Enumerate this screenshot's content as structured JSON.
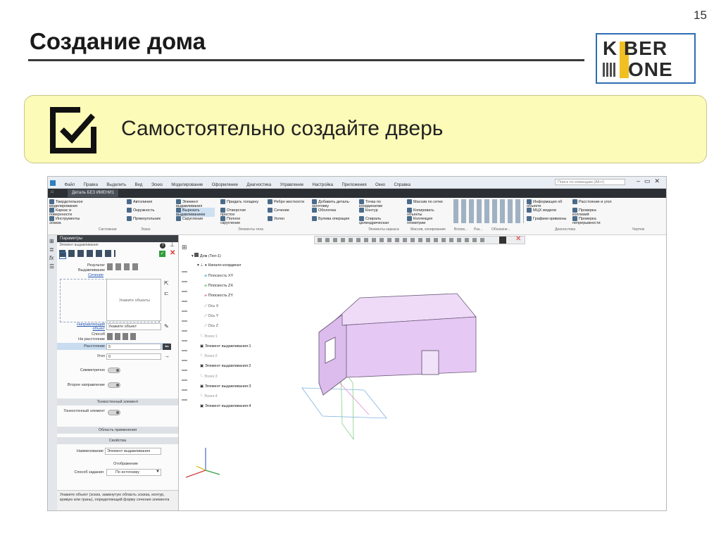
{
  "slide": {
    "number": "15",
    "title": "Создание дома",
    "task_text": "Самостоятельно создайте дверь"
  },
  "logo": {
    "line1": "K BER",
    "line2": "ONE",
    "accent_color": "#f0c020",
    "border_color": "#2f6db5"
  },
  "task_box": {
    "background": "#fdfbb8",
    "icon": "checkbox-checked-icon"
  },
  "app": {
    "menu": [
      "Файл",
      "Правка",
      "Выделить",
      "Вид",
      "Эскиз",
      "Моделирование",
      "Оформление",
      "Диагностика",
      "Управление",
      "Настройка",
      "Приложения",
      "Окно",
      "Справка"
    ],
    "search_placeholder": "Поиск по командам (Alt+/)",
    "doc_tab": "Деталь БЕЗ ИМЕНИ1",
    "ribbon": {
      "items": [
        {
          "label": "Твердотельное моделирование"
        },
        {
          "label": "Каркас и поверхности"
        },
        {
          "label": "Инструменты эскиза"
        },
        {
          "label": "Автолиния"
        },
        {
          "label": "Окружность"
        },
        {
          "label": "Прямоугольник"
        },
        {
          "label": "Элемент выдавливания"
        },
        {
          "label": "Вырезать выдавливанием"
        },
        {
          "label": "Скругление"
        },
        {
          "label": "Придать толщину"
        },
        {
          "label": "Отверстие простое"
        },
        {
          "label": "Полное скругление"
        },
        {
          "label": "Ребро жесткости"
        },
        {
          "label": "Сечение"
        },
        {
          "label": "Уклон"
        },
        {
          "label": "Добавить деталь-заготовку"
        },
        {
          "label": "Оболочка"
        },
        {
          "label": "Булева операция"
        },
        {
          "label": "Точка по координатам"
        },
        {
          "label": "Контур"
        },
        {
          "label": "Спираль цилиндрическая"
        },
        {
          "label": "Массив по сетке"
        },
        {
          "label": "Копировать объекты"
        },
        {
          "label": "Коллекция геометрии"
        },
        {
          "label": "Информация об объекте"
        },
        {
          "label": "МЦХ модели"
        },
        {
          "label": "Графики кривизны"
        },
        {
          "label": "Расстояние и угол"
        },
        {
          "label": "Проверка коллизий"
        },
        {
          "label": "Проверка непрерывности"
        }
      ],
      "groups": [
        "Системная",
        "Эскиз",
        "Элементы тела",
        "Элементы каркаса",
        "Массив, копирование",
        "Вспом...",
        "Раз...",
        "Обозначе...",
        "Диагностика",
        "Чертеж"
      ]
    },
    "panel": {
      "title": "Параметры",
      "subtitle": "Элемент выдавливания",
      "result_label": "Результат",
      "result_value": "Выдавливание",
      "section_link": "Сечение",
      "objects_hint": "Укажите объекты",
      "direction_link": "Направляющий объект",
      "direction_value": "Укажите объект",
      "method_label": "Способ",
      "method_value": "На расстояние",
      "distance_label": "Расстояние",
      "distance_value": "5",
      "angle_label": "Угол",
      "angle_value": "0",
      "symmetric_label": "Симметрично",
      "second_dir_label": "Второе направление",
      "thin_section": "Тонкостенный элемент",
      "thin_label": "Тонкостенный элемент",
      "scope_section": "Область применения",
      "props_section": "Свойства",
      "name_label": "Наименование",
      "name_value": "Элемент выдавливания",
      "display_label": "Отображение",
      "method2_label": "Способ задания",
      "method2_value": "По источнику",
      "status": "Укажите объект (эскиз, замкнутую область эскиза, контур, кривую или грань), определяющий форму сечения элемента"
    },
    "tree": [
      {
        "label": "Дом (Тел-1)"
      },
      {
        "label": "Начало координат"
      },
      {
        "label": "Плоскость XY"
      },
      {
        "label": "Плоскость ZX"
      },
      {
        "label": "Плоскость ZY"
      },
      {
        "label": "Ось X"
      },
      {
        "label": "Ось Y"
      },
      {
        "label": "Ось Z"
      },
      {
        "label": "Эскиз:1"
      },
      {
        "label": "Элемент выдавливания:1"
      },
      {
        "label": "Эскиз:2"
      },
      {
        "label": "Элемент выдавливания:2"
      },
      {
        "label": "Эскиз:3"
      },
      {
        "label": "Элемент выдавливания:3"
      },
      {
        "label": "Эскиз:4"
      },
      {
        "label": "Элемент выдавливания:4"
      }
    ],
    "house_color": "#e6c8f4"
  }
}
